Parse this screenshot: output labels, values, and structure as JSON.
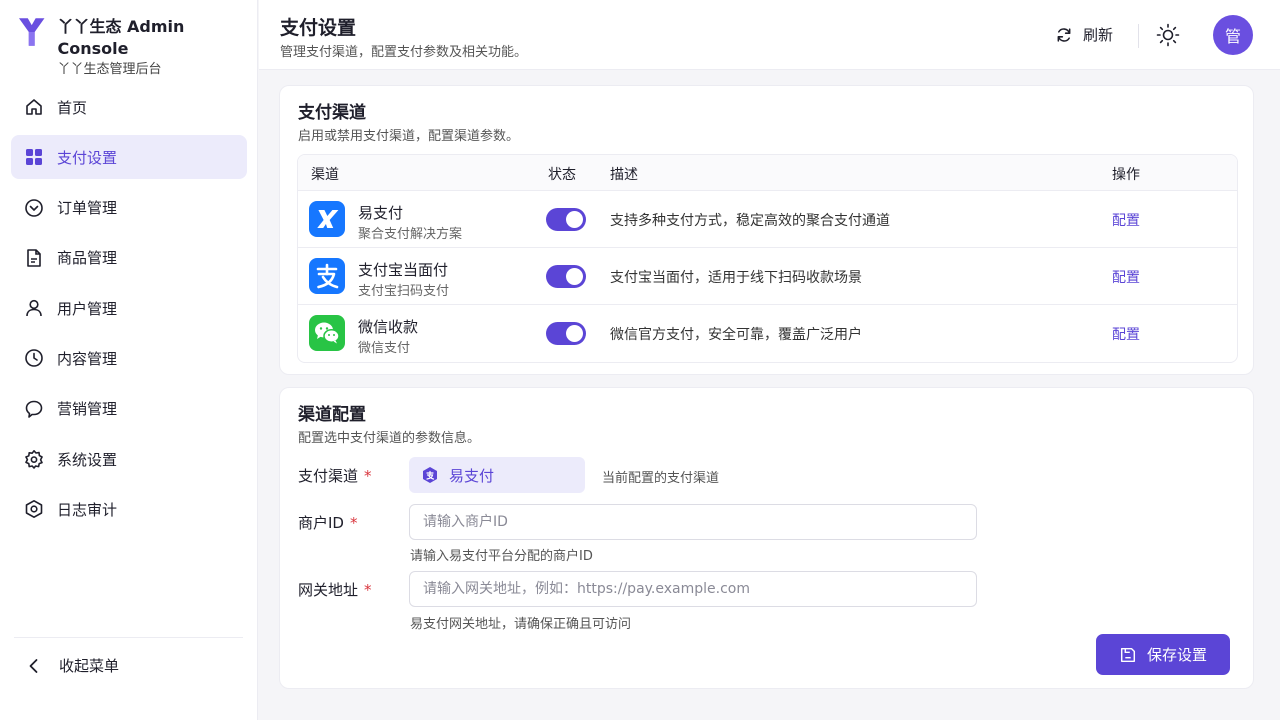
{
  "brand": {
    "title": "丫丫生态 Admin Console",
    "subtitle": "丫丫生态管理后台"
  },
  "sidebar": {
    "items": [
      {
        "label": "首页",
        "icon": "home-icon"
      },
      {
        "label": "支付设置",
        "icon": "grid-icon",
        "active": true
      },
      {
        "label": "订单管理",
        "icon": "check-circle-icon"
      },
      {
        "label": "商品管理",
        "icon": "document-icon"
      },
      {
        "label": "用户管理",
        "icon": "user-icon"
      },
      {
        "label": "内容管理",
        "icon": "clock-icon"
      },
      {
        "label": "营销管理",
        "icon": "chat-bubble-icon"
      },
      {
        "label": "系统设置",
        "icon": "gear-icon"
      },
      {
        "label": "日志审计",
        "icon": "shield-icon"
      }
    ],
    "collapse_label": "收起菜单"
  },
  "header": {
    "title": "支付设置",
    "subtitle": "管理支付渠道，配置支付参数及相关功能。",
    "refresh_label": "刷新",
    "avatar_text": "管"
  },
  "channels_card": {
    "title": "支付渠道",
    "subtitle": "启用或禁用支付渠道，配置渠道参数。",
    "columns": {
      "channel": "渠道",
      "status": "状态",
      "description": "描述",
      "action": "操作"
    },
    "rows": [
      {
        "name": "易支付",
        "sub": "聚合支付解决方案",
        "enabled": true,
        "description": "支持多种支付方式，稳定高效的聚合支付通道",
        "action": "配置",
        "logo_color": "#1677ff"
      },
      {
        "name": "支付宝当面付",
        "sub": "支付宝扫码支付",
        "enabled": true,
        "description": "支付宝当面付，适用于线下扫码收款场景",
        "action": "配置",
        "logo_color": "#1677ff"
      },
      {
        "name": "微信收款",
        "sub": "微信支付",
        "enabled": true,
        "description": "微信官方支付，安全可靠，覆盖广泛用户",
        "action": "配置",
        "logo_color": "#28c445"
      }
    ]
  },
  "config_card": {
    "title": "渠道配置",
    "subtitle": "配置选中支付渠道的参数信息。",
    "channel_label": "支付渠道",
    "channel_value": "易支付",
    "channel_note": "当前配置的支付渠道",
    "merchant_label": "商户ID",
    "merchant_placeholder": "请输入商户ID",
    "merchant_help": "请输入易支付平台分配的商户ID",
    "gateway_label": "网关地址",
    "gateway_placeholder": "请输入网关地址，例如：https://pay.example.com",
    "gateway_help": "易支付网关地址，请确保正确且可访问",
    "required_mark": "*",
    "save_label": "保存设置"
  },
  "colors": {
    "accent": "#5b45d6",
    "accent_light": "#ecebfb",
    "alipay": "#1677ff",
    "wechat": "#28c445"
  }
}
